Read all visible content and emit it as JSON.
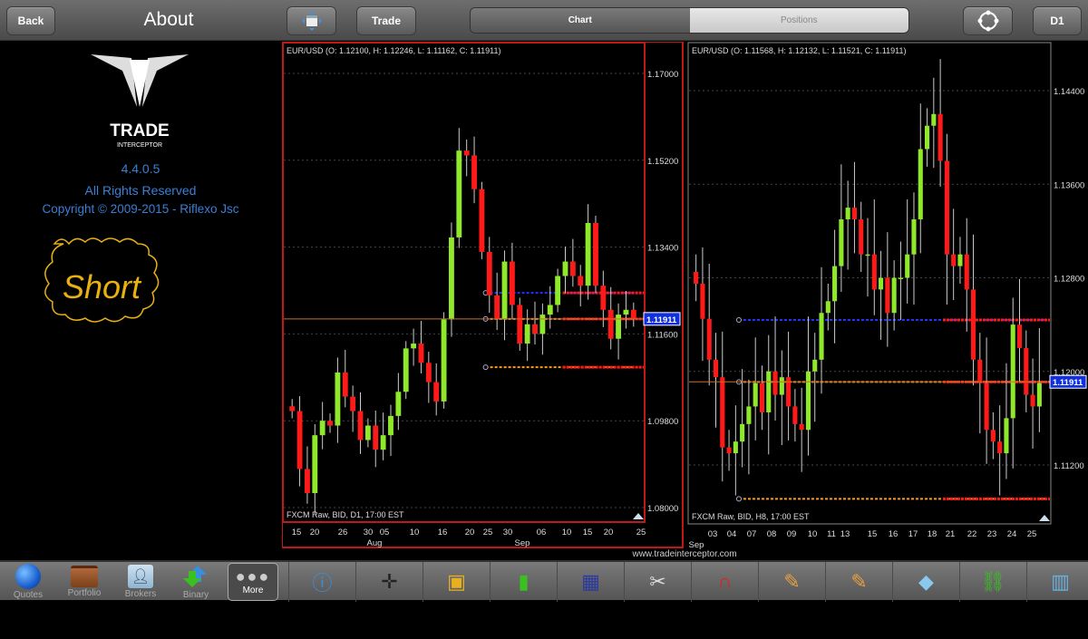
{
  "topbar": {
    "back": "Back",
    "title": "About",
    "trade": "Trade",
    "tabs": [
      {
        "label": "Chart",
        "active": true
      },
      {
        "label": "Positions",
        "active": false
      }
    ],
    "timeframe": "D1"
  },
  "about": {
    "brand": "TRADE",
    "brand_sub": "INTERCEPTOR",
    "version": "4.4.0.5",
    "rights": "All Rights Reserved",
    "copyright": "Copyright © 2009-2015 - Riflexo Jsc",
    "note": "Short"
  },
  "charts": [
    {
      "header": "EUR/USD (O: 1.12100, H: 1.12246, L: 1.11162, C: 1.11911)",
      "footer": "FXCM Raw, BID, D1, 17:00 EST",
      "price_label": "1.11911",
      "current": 1.11911,
      "yticks": [
        "1.17000",
        "1.15200",
        "1.13400",
        "1.11600",
        "1.09800",
        "1.08000"
      ],
      "ylim": [
        1.08,
        1.17
      ],
      "xticks": [
        "15",
        "20",
        "26",
        "30",
        "05",
        "10",
        "16",
        "20",
        "25",
        "30",
        "06",
        "10",
        "15",
        "20",
        "25"
      ],
      "months": [
        "Aug",
        "Sep"
      ],
      "closes": [
        1.1,
        1.088,
        1.083,
        1.095,
        1.098,
        1.097,
        1.108,
        1.103,
        1.1,
        1.094,
        1.097,
        1.092,
        1.095,
        1.099,
        1.104,
        1.113,
        1.114,
        1.11,
        1.106,
        1.102,
        1.119,
        1.136,
        1.154,
        1.153,
        1.146,
        1.133,
        1.124,
        1.119,
        1.131,
        1.122,
        1.114,
        1.118,
        1.116,
        1.12,
        1.122,
        1.128,
        1.131,
        1.128,
        1.126,
        1.139,
        1.126,
        1.121,
        1.115,
        1.12,
        1.121,
        1.119
      ],
      "levels": [
        {
          "price": 1.1245,
          "color": "#2233ff"
        },
        {
          "price": 1.1191,
          "color": "#ff9a1a"
        },
        {
          "price": 1.1091,
          "color": "#ff9a1a"
        }
      ]
    },
    {
      "header": "EUR/USD (O: 1.11568, H: 1.12132, L: 1.11521, C: 1.11911)",
      "footer": "FXCM Raw, BID, H8, 17:00 EST",
      "price_label": "1.11911",
      "current": 1.11911,
      "yticks": [
        "1.14400",
        "1.13600",
        "1.12800",
        "1.12000",
        "1.11200"
      ],
      "ylim": [
        1.1079,
        1.1475
      ],
      "xticks": [
        "03",
        "04",
        "07",
        "08",
        "09",
        "10",
        "11",
        "13",
        "15",
        "16",
        "17",
        "18",
        "21",
        "22",
        "23",
        "24",
        "25"
      ],
      "months": [
        "Sep"
      ],
      "closes": [
        1.1275,
        1.1245,
        1.121,
        1.1195,
        1.1135,
        1.113,
        1.114,
        1.1155,
        1.117,
        1.119,
        1.1165,
        1.12,
        1.118,
        1.1195,
        1.117,
        1.1155,
        1.115,
        1.12,
        1.121,
        1.125,
        1.126,
        1.129,
        1.133,
        1.134,
        1.133,
        1.13,
        1.13,
        1.127,
        1.128,
        1.125,
        1.128,
        1.128,
        1.13,
        1.133,
        1.139,
        1.141,
        1.142,
        1.138,
        1.13,
        1.129,
        1.13,
        1.127,
        1.121,
        1.119,
        1.115,
        1.114,
        1.113,
        1.116,
        1.124,
        1.122,
        1.118,
        1.117,
        1.119
      ],
      "levels": [
        {
          "price": 1.1244,
          "color": "#2233ff"
        },
        {
          "price": 1.1191,
          "color": "#ff9a1a"
        },
        {
          "price": 1.1091,
          "color": "#ff9a1a"
        }
      ]
    }
  ],
  "site": "www.tradeinterceptor.com",
  "toolbar": {
    "items": [
      {
        "label": "Quotes"
      },
      {
        "label": "Portfolio"
      },
      {
        "label": "Brokers"
      },
      {
        "label": "Binary"
      },
      {
        "label": "More"
      }
    ],
    "tools": [
      "info-icon",
      "crosshair-icon",
      "frame-icon",
      "bar-chart-icon",
      "grid-icon",
      "tools-icon",
      "magnet-icon",
      "pencil-icon",
      "pencil-alert-icon",
      "eraser-icon",
      "link-icon",
      "chart-settings-icon"
    ]
  },
  "colors": {
    "bull": "#8fe82a",
    "bear": "#ff1a1a",
    "accent": "#3a7fd5",
    "note": "#e8b010"
  }
}
